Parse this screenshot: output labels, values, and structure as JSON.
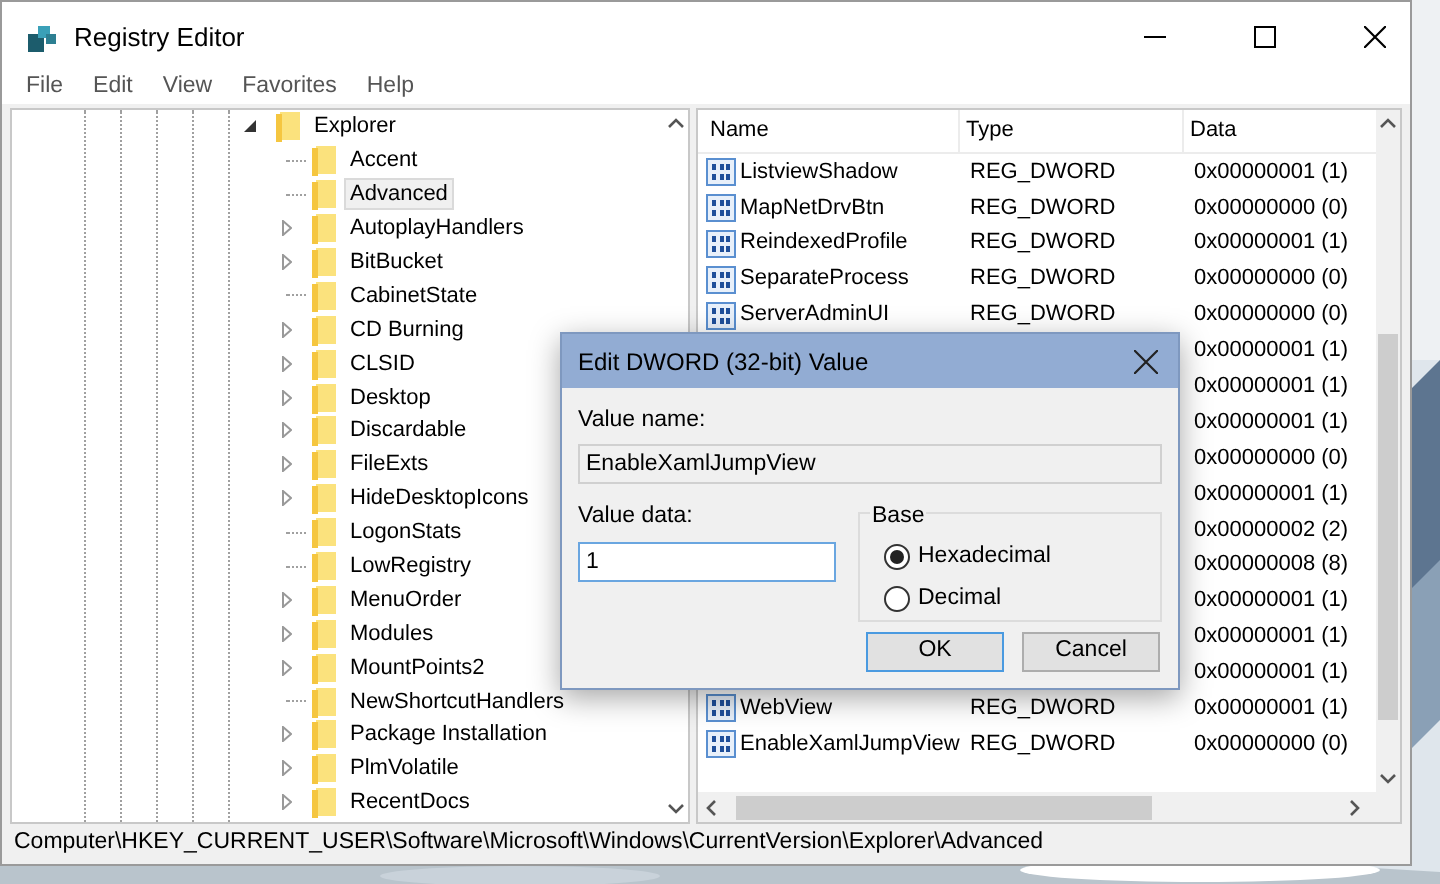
{
  "window": {
    "title": "Registry Editor"
  },
  "menu": [
    "File",
    "Edit",
    "View",
    "Favorites",
    "Help"
  ],
  "tree": {
    "items": [
      {
        "label": "Explorer",
        "expanded": true,
        "selected": false,
        "children": [
          {
            "label": "Accent",
            "expandable": false,
            "selected": false
          },
          {
            "label": "Advanced",
            "expandable": false,
            "selected": true
          },
          {
            "label": "AutoplayHandlers",
            "expandable": true,
            "selected": false
          },
          {
            "label": "BitBucket",
            "expandable": true,
            "selected": false
          },
          {
            "label": "CabinetState",
            "expandable": false,
            "selected": false
          },
          {
            "label": "CD Burning",
            "expandable": true,
            "selected": false
          },
          {
            "label": "CLSID",
            "expandable": true,
            "selected": false
          },
          {
            "label": "Desktop",
            "expandable": true,
            "selected": false
          },
          {
            "label": "Discardable",
            "expandable": true,
            "selected": false
          },
          {
            "label": "FileExts",
            "expandable": true,
            "selected": false
          },
          {
            "label": "HideDesktopIcons",
            "expandable": true,
            "selected": false
          },
          {
            "label": "LogonStats",
            "expandable": false,
            "selected": false
          },
          {
            "label": "LowRegistry",
            "expandable": false,
            "selected": false
          },
          {
            "label": "MenuOrder",
            "expandable": true,
            "selected": false
          },
          {
            "label": "Modules",
            "expandable": true,
            "selected": false
          },
          {
            "label": "MountPoints2",
            "expandable": true,
            "selected": false
          },
          {
            "label": "NewShortcutHandlers",
            "expandable": false,
            "selected": false
          },
          {
            "label": "Package Installation",
            "expandable": true,
            "selected": false
          },
          {
            "label": "PlmVolatile",
            "expandable": true,
            "selected": false
          },
          {
            "label": "RecentDocs",
            "expandable": true,
            "selected": false
          }
        ]
      }
    ]
  },
  "list": {
    "columns": [
      "Name",
      "Type",
      "Data"
    ],
    "rows": [
      {
        "name": "ListviewShadow",
        "type": "REG_DWORD",
        "data": "0x00000001 (1)"
      },
      {
        "name": "MapNetDrvBtn",
        "type": "REG_DWORD",
        "data": "0x00000000 (0)"
      },
      {
        "name": "ReindexedProfile",
        "type": "REG_DWORD",
        "data": "0x00000001 (1)"
      },
      {
        "name": "SeparateProcess",
        "type": "REG_DWORD",
        "data": "0x00000000 (0)"
      },
      {
        "name": "ServerAdminUI",
        "type": "REG_DWORD",
        "data": "0x00000000 (0)"
      },
      {
        "data": "0x00000001 (1)"
      },
      {
        "data": "0x00000001 (1)"
      },
      {
        "data": "0x00000001 (1)"
      },
      {
        "data": "0x00000000 (0)"
      },
      {
        "data": "0x00000001 (1)"
      },
      {
        "data": "0x00000002 (2)"
      },
      {
        "data": "0x00000008 (8)"
      },
      {
        "data": "0x00000001 (1)"
      },
      {
        "data": "0x00000001 (1)"
      },
      {
        "data": "0x00000001 (1)"
      },
      {
        "name": "WebView",
        "type": "REG_DWORD",
        "data": "0x00000001 (1)"
      },
      {
        "name": "EnableXamlJumpView",
        "type": "REG_DWORD",
        "data": "0x00000000 (0)"
      }
    ]
  },
  "status_bar": "Computer\\HKEY_CURRENT_USER\\Software\\Microsoft\\Windows\\CurrentVersion\\Explorer\\Advanced",
  "dialog": {
    "title": "Edit DWORD (32-bit) Value",
    "value_name_label": "Value name:",
    "value_name": "EnableXamlJumpView",
    "value_data_label": "Value data:",
    "value_data": "1",
    "base_label": "Base",
    "base_options": [
      {
        "label": "Hexadecimal",
        "selected": true
      },
      {
        "label": "Decimal",
        "selected": false
      }
    ],
    "buttons": [
      "OK",
      "Cancel"
    ]
  }
}
